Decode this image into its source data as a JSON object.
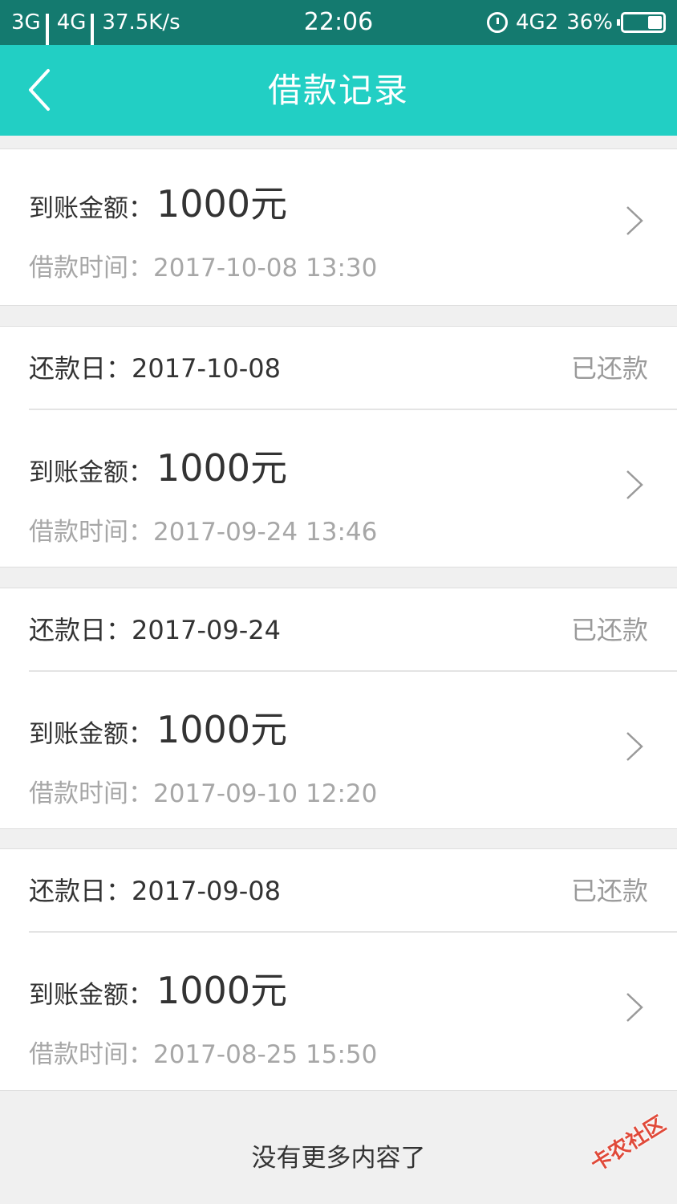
{
  "status_bar": {
    "net1": "3G",
    "net2": "4G",
    "speed": "37.5K/s",
    "time": "22:06",
    "volte": "4G2",
    "battery": "36%",
    "battery_level": 0.36
  },
  "header": {
    "title": "借款记录",
    "back_icon": "chevron-left-icon"
  },
  "records": [
    {
      "amount_label": "到账金额：",
      "amount": "1000元",
      "time_label": "借款时间：",
      "time": "2017-10-08 13:30"
    },
    {
      "due_label": "还款日：",
      "due_date": "2017-10-08",
      "status": "已还款",
      "amount_label": "到账金额：",
      "amount": "1000元",
      "time_label": "借款时间：",
      "time": "2017-09-24 13:46"
    },
    {
      "due_label": "还款日：",
      "due_date": "2017-09-24",
      "status": "已还款",
      "amount_label": "到账金额：",
      "amount": "1000元",
      "time_label": "借款时间：",
      "time": "2017-09-10 12:20"
    },
    {
      "due_label": "还款日：",
      "due_date": "2017-09-08",
      "status": "已还款",
      "amount_label": "到账金额：",
      "amount": "1000元",
      "time_label": "借款时间：",
      "time": "2017-08-25 15:50"
    }
  ],
  "footer": {
    "message": "没有更多内容了"
  },
  "watermark": "卡农社区",
  "colors": {
    "status_bar": "#147a6f",
    "nav_bar": "#22cfc4",
    "background": "#f0f0f0"
  }
}
